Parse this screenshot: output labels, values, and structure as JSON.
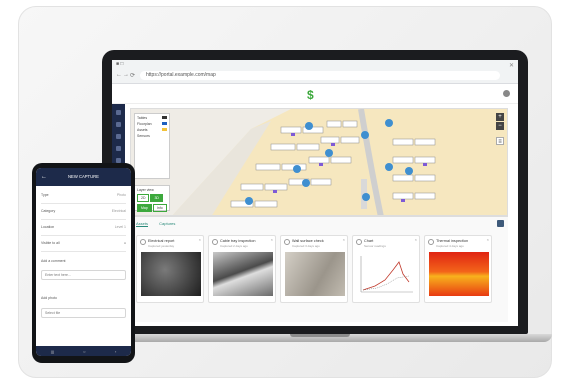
{
  "browser": {
    "tab_title": "■ □",
    "url": "https://portal.example.com/map",
    "back_icon": "←",
    "forward_icon": "→",
    "reload_icon": "⟳",
    "close_icon": "✕"
  },
  "app": {
    "logo": "$"
  },
  "map": {
    "legend": [
      {
        "label": "Tables",
        "color": "#333333"
      },
      {
        "label": "Floorplan",
        "color": "#1d5fbf"
      },
      {
        "label": "Assets",
        "color": "#f2c23a"
      },
      {
        "label": "Sensors",
        "color": ""
      }
    ],
    "toggle_title": "Layer view",
    "toggle_buttons": [
      "2D",
      "3D",
      "Map",
      "Info"
    ],
    "zoom_in": "+",
    "zoom_out": "−",
    "layers_icon": "≡"
  },
  "panel": {
    "tabs": [
      "Assets",
      "Captures"
    ],
    "cards": [
      {
        "title": "Electrical report",
        "sub": "Captured yesterday"
      },
      {
        "title": "Cable tray inspection",
        "sub": "Captured 2 days ago"
      },
      {
        "title": "Wall surface check",
        "sub": "Captured 3 days ago"
      },
      {
        "title": "Chart",
        "sub": "Sensor readings"
      },
      {
        "title": "Thermal inspection",
        "sub": "Captured 4 days ago"
      }
    ]
  },
  "phone": {
    "header": "NEW CAPTURE",
    "back_icon": "←",
    "fields": [
      {
        "label": "Type",
        "value": "Photo"
      },
      {
        "label": "Category",
        "value": "Electrical"
      },
      {
        "label": "Location",
        "value": "Level 1"
      },
      {
        "label": "Visible to all",
        "value": "●"
      }
    ],
    "note_label": "Add a comment",
    "note_placeholder": "Enter text here...",
    "photo_label": "Add photo",
    "photo_placeholder": "Select file",
    "bottom_nav": [
      "|||",
      "○",
      "‹"
    ]
  }
}
